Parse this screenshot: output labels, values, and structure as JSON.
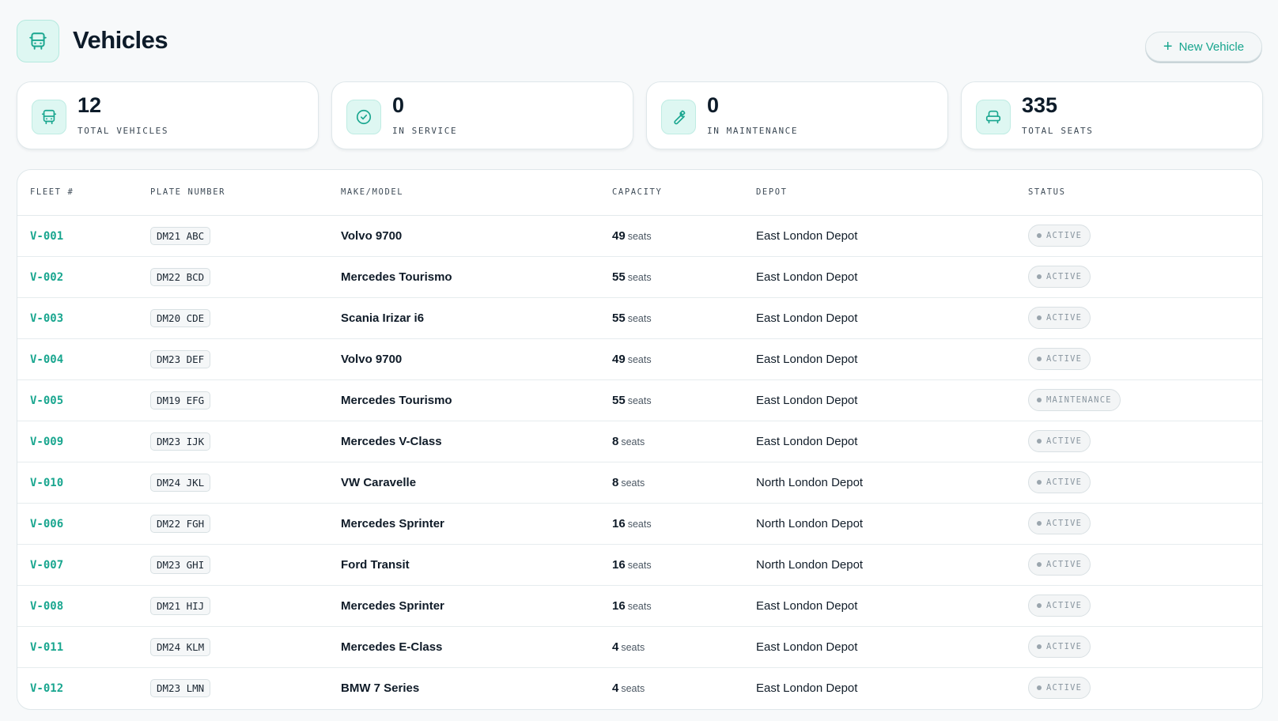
{
  "header": {
    "title": "Vehicles",
    "icon": "bus-icon",
    "new_button_label": "New Vehicle"
  },
  "stats": [
    {
      "value": "12",
      "label": "TOTAL VEHICLES",
      "icon": "bus-icon"
    },
    {
      "value": "0",
      "label": "IN SERVICE",
      "icon": "check-circle-icon"
    },
    {
      "value": "0",
      "label": "IN MAINTENANCE",
      "icon": "wrench-icon"
    },
    {
      "value": "335",
      "label": "TOTAL SEATS",
      "icon": "seat-icon"
    }
  ],
  "table": {
    "columns": [
      "FLEET #",
      "PLATE NUMBER",
      "MAKE/MODEL",
      "CAPACITY",
      "DEPOT",
      "STATUS"
    ],
    "seats_unit": "seats",
    "rows": [
      {
        "fleet": "V-001",
        "plate": "DM21 ABC",
        "model": "Volvo 9700",
        "capacity": "49",
        "depot": "East London Depot",
        "status": "ACTIVE"
      },
      {
        "fleet": "V-002",
        "plate": "DM22 BCD",
        "model": "Mercedes Tourismo",
        "capacity": "55",
        "depot": "East London Depot",
        "status": "ACTIVE"
      },
      {
        "fleet": "V-003",
        "plate": "DM20 CDE",
        "model": "Scania Irizar i6",
        "capacity": "55",
        "depot": "East London Depot",
        "status": "ACTIVE"
      },
      {
        "fleet": "V-004",
        "plate": "DM23 DEF",
        "model": "Volvo 9700",
        "capacity": "49",
        "depot": "East London Depot",
        "status": "ACTIVE"
      },
      {
        "fleet": "V-005",
        "plate": "DM19 EFG",
        "model": "Mercedes Tourismo",
        "capacity": "55",
        "depot": "East London Depot",
        "status": "MAINTENANCE"
      },
      {
        "fleet": "V-009",
        "plate": "DM23 IJK",
        "model": "Mercedes V-Class",
        "capacity": "8",
        "depot": "East London Depot",
        "status": "ACTIVE"
      },
      {
        "fleet": "V-010",
        "plate": "DM24 JKL",
        "model": "VW Caravelle",
        "capacity": "8",
        "depot": "North London Depot",
        "status": "ACTIVE"
      },
      {
        "fleet": "V-006",
        "plate": "DM22 FGH",
        "model": "Mercedes Sprinter",
        "capacity": "16",
        "depot": "North London Depot",
        "status": "ACTIVE"
      },
      {
        "fleet": "V-007",
        "plate": "DM23 GHI",
        "model": "Ford Transit",
        "capacity": "16",
        "depot": "North London Depot",
        "status": "ACTIVE"
      },
      {
        "fleet": "V-008",
        "plate": "DM21 HIJ",
        "model": "Mercedes Sprinter",
        "capacity": "16",
        "depot": "East London Depot",
        "status": "ACTIVE"
      },
      {
        "fleet": "V-011",
        "plate": "DM24 KLM",
        "model": "Mercedes E-Class",
        "capacity": "4",
        "depot": "East London Depot",
        "status": "ACTIVE"
      },
      {
        "fleet": "V-012",
        "plate": "DM23 LMN",
        "model": "BMW 7 Series",
        "capacity": "4",
        "depot": "East London Depot",
        "status": "ACTIVE"
      }
    ]
  },
  "colors": {
    "accent": "#19a68f",
    "accent_bg": "#def7f2",
    "page_bg": "#f7f9fa"
  }
}
